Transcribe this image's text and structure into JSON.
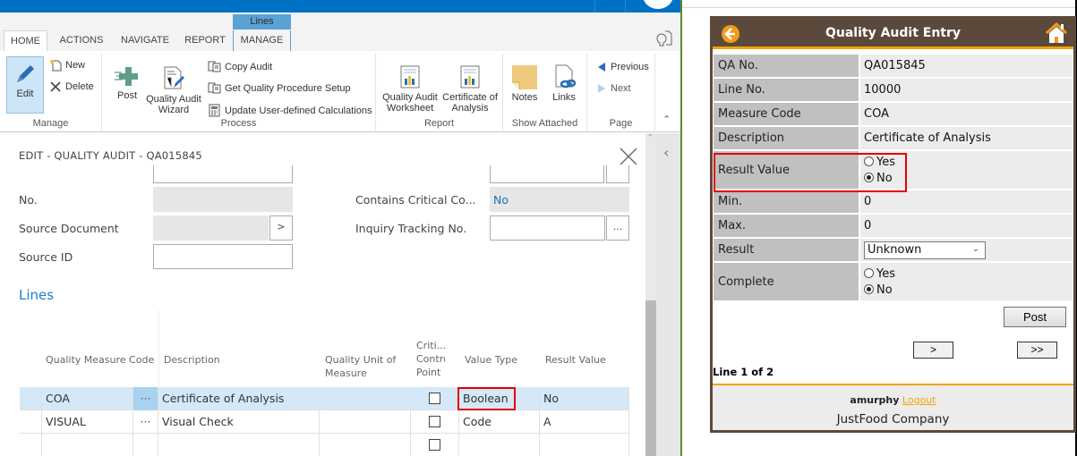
{
  "ribbon": {
    "contextual_header": "Lines",
    "tabs": [
      {
        "label": "HOME",
        "active": true
      },
      {
        "label": "ACTIONS",
        "active": false
      },
      {
        "label": "NAVIGATE",
        "active": false
      },
      {
        "label": "REPORT",
        "active": false
      },
      {
        "label": "MANAGE",
        "active": false
      }
    ],
    "groups": {
      "manage": {
        "label": "Manage",
        "edit": "Edit",
        "new": "New",
        "delete": "Delete"
      },
      "process": {
        "label": "Process",
        "post": "Post",
        "wizard": "Quality Audit Wizard",
        "copy_audit": "Copy Audit",
        "get_setup": "Get Quality Procedure Setup",
        "update_calc": "Update User-defined Calculations"
      },
      "report": {
        "label": "Report",
        "worksheet": "Quality Audit Worksheet",
        "coa": "Certificate of Analysis"
      },
      "show_attached": {
        "label": "Show Attached",
        "notes": "Notes",
        "links": "Links"
      },
      "page": {
        "label": "Page",
        "previous": "Previous",
        "next": "Next"
      }
    }
  },
  "form": {
    "title": "EDIT - QUALITY AUDIT - QA015845",
    "fields": {
      "no_label": "No.",
      "source_document_label": "Source Document",
      "source_id_label": "Source ID",
      "contains_critical_label": "Contains Critical Co...",
      "contains_critical_value": "No",
      "inquiry_tracking_label": "Inquiry Tracking No.",
      "lookup_btn": "...",
      "drill_btn": ">"
    },
    "lines_header": "Lines",
    "grid": {
      "columns": [
        "Quality Measure Code",
        "Description",
        "Quality Unit of Measure",
        "Criti... Control Point",
        "Value Type",
        "Result Value"
      ],
      "rows": [
        {
          "code": "COA",
          "description": "Certificate of Analysis",
          "uom": "",
          "critical": false,
          "value_type": "Boolean",
          "result_value": "No",
          "selected": true
        },
        {
          "code": "VISUAL",
          "description": "Visual Check",
          "uom": "",
          "critical": false,
          "value_type": "Code",
          "result_value": "A",
          "selected": false
        },
        {
          "code": "",
          "description": "",
          "uom": "",
          "critical": false,
          "value_type": "",
          "result_value": "",
          "selected": false
        }
      ]
    }
  },
  "mobile": {
    "title": "Quality Audit Entry",
    "rows": {
      "qa_no": {
        "label": "QA No.",
        "value": "QA015845"
      },
      "line_no": {
        "label": "Line No.",
        "value": "10000"
      },
      "measure_code": {
        "label": "Measure Code",
        "value": "COA"
      },
      "description": {
        "label": "Description",
        "value": "Certificate of Analysis"
      },
      "result_value": {
        "label": "Result Value",
        "yes": "Yes",
        "no": "No",
        "selected": "No"
      },
      "min": {
        "label": "Min.",
        "value": "0"
      },
      "max": {
        "label": "Max.",
        "value": "0"
      },
      "result": {
        "label": "Result",
        "value": "Unknown"
      },
      "complete": {
        "label": "Complete",
        "yes": "Yes",
        "no": "No",
        "selected": "No"
      }
    },
    "post_button": "Post",
    "next_button": ">",
    "last_button": ">>",
    "line_count": "Line 1 of 2",
    "user": "amurphy",
    "logout": "Logout",
    "company": "JustFood Company"
  }
}
